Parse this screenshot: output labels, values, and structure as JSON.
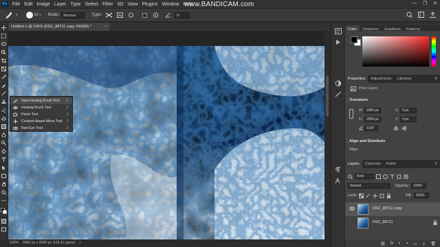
{
  "menu": {
    "app_icon": "Ps",
    "items": [
      "File",
      "Edit",
      "Image",
      "Layer",
      "Type",
      "Select",
      "Filter",
      "3D",
      "View",
      "Plugins",
      "Window",
      "Help"
    ]
  },
  "watermark": {
    "pre": "www.",
    "brand": "BANDICAM",
    "post": ".com"
  },
  "window_controls": [
    "—",
    "❐",
    "✕"
  ],
  "options_bar": {
    "tool_icon": "spot-healing-brush-icon",
    "brush_size": "19",
    "mode_label": "Mode:",
    "mode_value": "Normal",
    "type_label": "Type:",
    "angle_value": "0°"
  },
  "document": {
    "tab_title": "Untitled-1 @ 100% (DSC_88711 copy, RGB/8) *",
    "close": "×"
  },
  "flyout": {
    "items": [
      {
        "label": "Spot Healing Brush Tool",
        "key": "J",
        "icon": "spot-healing-brush-icon",
        "selected": true
      },
      {
        "label": "Healing Brush Tool",
        "key": "J",
        "icon": "healing-brush-icon",
        "selected": false
      },
      {
        "label": "Patch Tool",
        "key": "J",
        "icon": "patch-icon",
        "selected": false
      },
      {
        "label": "Content-Aware Move Tool",
        "key": "J",
        "icon": "content-aware-move-icon",
        "selected": false
      },
      {
        "label": "Red Eye Tool",
        "key": "J",
        "icon": "red-eye-icon",
        "selected": false
      }
    ]
  },
  "status": {
    "zoom": "100%",
    "info": "2000 px x 2000 px (118,11 ppcm)",
    "arrow": ">"
  },
  "panels": {
    "color_tabs": [
      "Color",
      "Swatches",
      "Gradients",
      "Patterns"
    ],
    "props_tabs": [
      "Properties",
      "Adjustments",
      "Libraries"
    ],
    "layer_type": "Pixel Layer",
    "transform": {
      "title": "Transform",
      "w_label": "W",
      "w_value": "2000 px",
      "x_label": "X",
      "x_value": "0 px",
      "h_label": "H",
      "h_value": "2000 px",
      "y_label": "Y",
      "y_value": "0 px",
      "angle_value": "0,00°"
    },
    "align": {
      "title": "Align and Distribute",
      "align_label": "Align:"
    },
    "layers_tabs": [
      "Layers",
      "Channels",
      "Paths"
    ],
    "layers_filter": "Kind",
    "blend_mode": "Normal",
    "opacity_label": "Opacity:",
    "opacity_value": "100%",
    "lock_label": "Lock:",
    "fill_label": "Fill:",
    "fill_value": "100%",
    "layers": [
      {
        "name": "DSC_88711 copy",
        "selected": true,
        "visible": true,
        "locked": false
      },
      {
        "name": "DSC_88711",
        "selected": false,
        "visible": false,
        "locked": true
      }
    ],
    "footer_icons": [
      "link-icon",
      "fx-icon",
      "mask-icon",
      "adjustment-icon",
      "folder-icon",
      "new-layer-icon",
      "trash-icon"
    ],
    "footer_labels": [
      "⛓",
      "fx",
      "◐",
      "◑",
      "▭",
      "＋",
      "🗑"
    ]
  },
  "colors": {
    "accent": "#1473e6",
    "panel": "#424242",
    "dark": "#323232"
  }
}
